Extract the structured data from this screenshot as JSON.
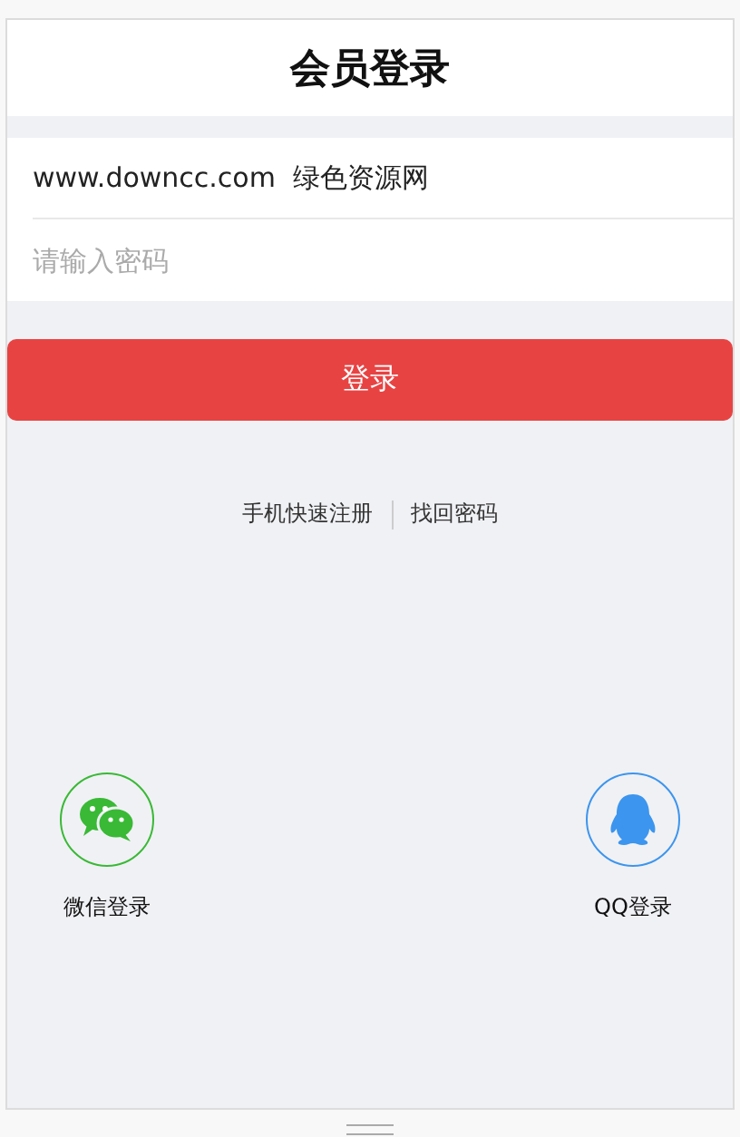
{
  "header": {
    "title": "会员登录"
  },
  "fields": [
    {
      "kind": "text",
      "value": "www.downcc.com  绿色资源网"
    },
    {
      "kind": "password",
      "placeholder": "请输入密码"
    }
  ],
  "login_button": "登录",
  "links": [
    "手机快速注册",
    "找回密码"
  ],
  "social_logins": [
    {
      "kind": "wechat",
      "label": "微信登录"
    },
    {
      "kind": "qq",
      "label": "QQ登录"
    }
  ]
}
